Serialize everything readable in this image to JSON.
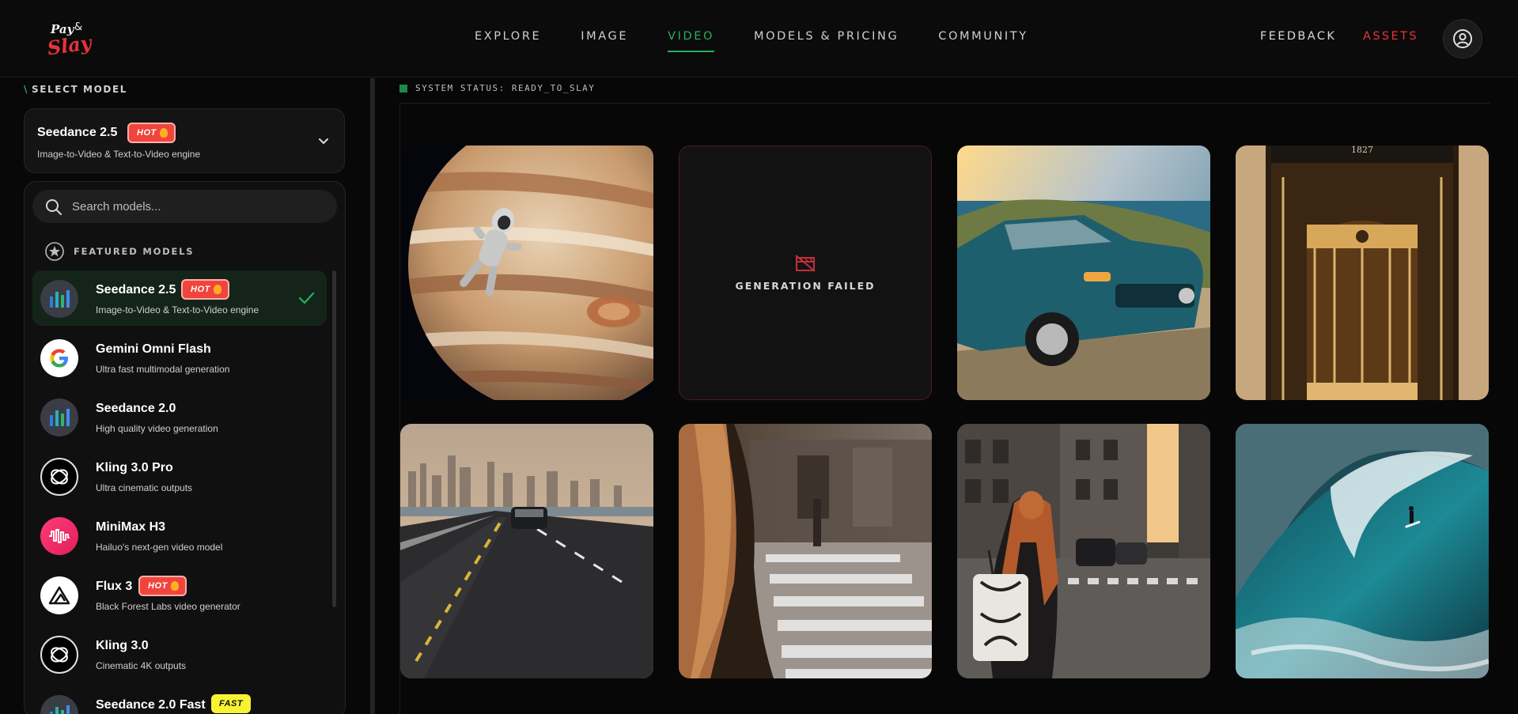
{
  "header": {
    "logo_text": "Pay & Slay",
    "nav": [
      {
        "label": "EXPLORE",
        "active": false
      },
      {
        "label": "IMAGE",
        "active": false
      },
      {
        "label": "VIDEO",
        "active": true
      },
      {
        "label": "MODELS & PRICING",
        "active": false
      },
      {
        "label": "COMMUNITY",
        "active": false
      }
    ],
    "feedback_label": "FEEDBACK",
    "assets_label": "ASSETS",
    "accent_color": "#22b35a",
    "assets_color": "#e8323c"
  },
  "sidebar": {
    "select_label": "SELECT MODEL",
    "selected_model": {
      "name": "Seedance 2.5",
      "badge": "HOT",
      "desc": "Image-to-Video & Text-to-Video engine"
    },
    "search_placeholder": "Search models...",
    "featured_label": "FEATURED MODELS",
    "models": [
      {
        "name": "Seedance 2.5",
        "desc": "Image-to-Video & Text-to-Video engine",
        "badge": "HOT",
        "icon": "seedance-icon",
        "selected": true
      },
      {
        "name": "Gemini Omni Flash",
        "desc": "Ultra fast multimodal generation",
        "badge": "",
        "icon": "google-icon",
        "selected": false
      },
      {
        "name": "Seedance 2.0",
        "desc": "High quality video generation",
        "badge": "",
        "icon": "seedance-icon",
        "selected": false
      },
      {
        "name": "Kling 3.0 Pro",
        "desc": "Ultra cinematic outputs",
        "badge": "",
        "icon": "kling-icon",
        "selected": false
      },
      {
        "name": "MiniMax H3",
        "desc": "Hailuo's next-gen video model",
        "badge": "",
        "icon": "minimax-icon",
        "selected": false
      },
      {
        "name": "Flux 3",
        "desc": "Black Forest Labs video generator",
        "badge": "HOT",
        "icon": "flux-icon",
        "selected": false
      },
      {
        "name": "Kling 3.0",
        "desc": "Cinematic 4K outputs",
        "badge": "",
        "icon": "kling-icon",
        "selected": false
      },
      {
        "name": "Seedance 2.0 Fast",
        "desc": "",
        "badge": "FAST",
        "icon": "seedance-icon",
        "selected": false
      }
    ]
  },
  "main": {
    "status_text": "SYSTEM STATUS: READY_TO_SLAY",
    "status_color": "#1a8a46",
    "failed_text": "GENERATION FAILED",
    "tiles": [
      {
        "kind": "astronaut-jupiter-thumbnail"
      },
      {
        "kind": "failed"
      },
      {
        "kind": "teal-car-coast-thumbnail"
      },
      {
        "kind": "revolving-door-thumbnail",
        "sign": "1827"
      },
      {
        "kind": "city-road-thumbnail"
      },
      {
        "kind": "crosswalk-hair-thumbnail"
      },
      {
        "kind": "woman-street-thumbnail"
      },
      {
        "kind": "surfer-wave-thumbnail"
      }
    ]
  }
}
